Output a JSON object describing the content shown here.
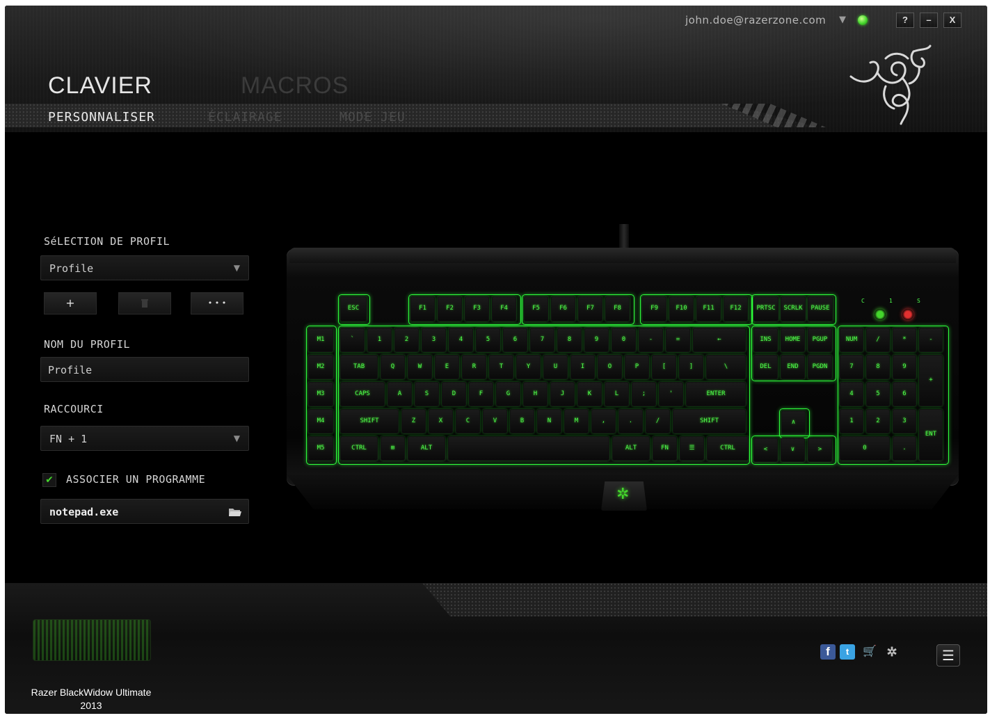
{
  "header": {
    "email": "john.doe@razerzone.com",
    "main_tabs": [
      {
        "label": "CLAVIER",
        "active": true
      },
      {
        "label": "MACROS",
        "active": false
      }
    ],
    "sub_tabs": [
      {
        "label": "PERSONNALISER",
        "active": true
      },
      {
        "label": "ÉCLAIRAGE",
        "active": false
      },
      {
        "label": "MODE JEU",
        "active": false
      }
    ],
    "window_buttons": {
      "help": "?",
      "minimize": "–",
      "close": "X"
    },
    "status_color": "#44d62c"
  },
  "profile": {
    "selection_label": "SéLECTION DE PROFIL",
    "selected_profile": "Profile",
    "add_button": "+",
    "delete_button_icon": "trash-icon",
    "more_button": "• • •",
    "name_label": "NOM DU PROFIL",
    "name_value": "Profile",
    "shortcut_label": "RACCOURCI",
    "shortcut_value": "FN + 1",
    "link_program_label": "ASSOCIER UN PROGRAMME",
    "link_program_checked": true,
    "program_value": "notepad.exe"
  },
  "keyboard": {
    "accent_color": "#44d62c",
    "macro_keys": [
      "M1",
      "M2",
      "M3",
      "M4",
      "M5"
    ],
    "esc": "ESC",
    "f_keys": [
      "F1",
      "F2",
      "F3",
      "F4",
      "F5",
      "F6",
      "F7",
      "F8",
      "F9",
      "F10",
      "F11",
      "F12"
    ],
    "system_keys": [
      "PRTSC",
      "SCRLK",
      "PAUSE"
    ],
    "led_labels": [
      "C",
      "1",
      "S"
    ],
    "row_number": [
      "`",
      "1",
      "2",
      "3",
      "4",
      "5",
      "6",
      "7",
      "8",
      "9",
      "0",
      "-",
      "=",
      "←"
    ],
    "row_tab": [
      "TAB",
      "Q",
      "W",
      "E",
      "R",
      "T",
      "Y",
      "U",
      "I",
      "O",
      "P",
      "[",
      "]",
      "\\"
    ],
    "row_caps": [
      "CAPS",
      "A",
      "S",
      "D",
      "F",
      "G",
      "H",
      "J",
      "K",
      "L",
      ";",
      "'",
      "ENTER"
    ],
    "row_shift": [
      "SHIFT",
      "Z",
      "X",
      "C",
      "V",
      "B",
      "N",
      "M",
      ",",
      ".",
      "/",
      "SHIFT"
    ],
    "row_ctrl": [
      "CTRL",
      "⊞",
      "ALT",
      "",
      "ALT",
      "FN",
      "☰",
      "CTRL"
    ],
    "nav_top": [
      "INS",
      "HOME",
      "PGUP"
    ],
    "nav_bottom": [
      "DEL",
      "END",
      "PGDN"
    ],
    "arrows": [
      "∧",
      "<",
      "∨",
      ">"
    ],
    "numpad_row1": [
      "NUM",
      "/",
      "*",
      "-"
    ],
    "numpad_row2": [
      "7",
      "8",
      "9",
      "+"
    ],
    "numpad_row3": [
      "4",
      "5",
      "6"
    ],
    "numpad_row4": [
      "1",
      "2",
      "3",
      "ENT"
    ],
    "numpad_row5": [
      "0",
      "."
    ]
  },
  "footer": {
    "device_name": "Razer BlackWidow Ultimate 2013",
    "social_icons": [
      "facebook-icon",
      "twitter-icon",
      "store-icon",
      "synapse-icon"
    ],
    "menu_icon": "menu-icon"
  }
}
